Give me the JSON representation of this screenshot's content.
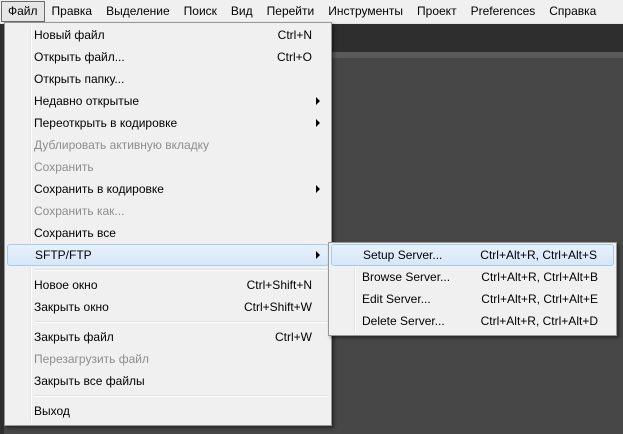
{
  "menubar": {
    "items": [
      "Файл",
      "Правка",
      "Выделение",
      "Поиск",
      "Вид",
      "Перейти",
      "Инструменты",
      "Проект",
      "Preferences",
      "Справка"
    ]
  },
  "file_menu": {
    "new_file": {
      "label": "Новый файл",
      "shortcut": "Ctrl+N"
    },
    "open_file": {
      "label": "Открыть файл...",
      "shortcut": "Ctrl+O"
    },
    "open_folder": {
      "label": "Открыть папку..."
    },
    "recent": {
      "label": "Недавно открытые"
    },
    "reopen_encoding": {
      "label": "Переоткрыть в кодировке"
    },
    "duplicate_tab": {
      "label": "Дублировать активную вкладку"
    },
    "save": {
      "label": "Сохранить"
    },
    "save_encoding": {
      "label": "Сохранить в кодировке"
    },
    "save_as": {
      "label": "Сохранить как..."
    },
    "save_all": {
      "label": "Сохранить все"
    },
    "sftp": {
      "label": "SFTP/FTP"
    },
    "new_window": {
      "label": "Новое окно",
      "shortcut": "Ctrl+Shift+N"
    },
    "close_window": {
      "label": "Закрыть окно",
      "shortcut": "Ctrl+Shift+W"
    },
    "close_file": {
      "label": "Закрыть файл",
      "shortcut": "Ctrl+W"
    },
    "reload_file": {
      "label": "Перезагрузить файл"
    },
    "close_all": {
      "label": "Закрыть все файлы"
    },
    "exit": {
      "label": "Выход"
    }
  },
  "sftp_menu": {
    "setup": {
      "label": "Setup Server...",
      "shortcut": "Ctrl+Alt+R, Ctrl+Alt+S"
    },
    "browse": {
      "label": "Browse Server...",
      "shortcut": "Ctrl+Alt+R, Ctrl+Alt+B"
    },
    "edit": {
      "label": "Edit Server...",
      "shortcut": "Ctrl+Alt+R, Ctrl+Alt+E"
    },
    "delete": {
      "label": "Delete Server...",
      "shortcut": "Ctrl+Alt+R, Ctrl+Alt+D"
    }
  },
  "colors": {
    "highlight": "#d6e7f8",
    "menu_bg": "#f0f0f0",
    "editor_bg": "#474747",
    "disabled": "#8d8d8d"
  }
}
